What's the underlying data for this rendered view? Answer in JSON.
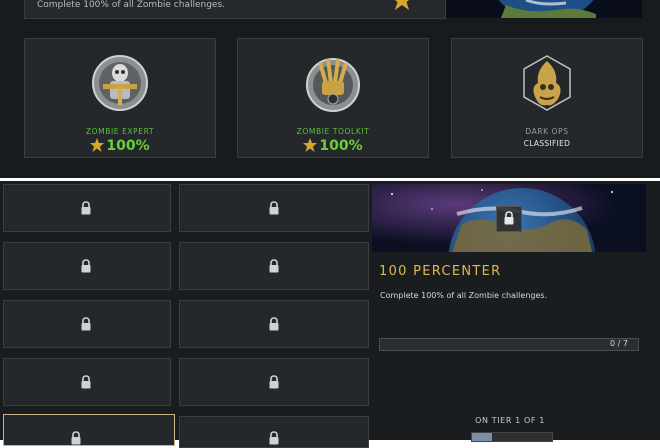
{
  "top": {
    "description": "Complete 100% of all Zombie challenges.",
    "cards": [
      {
        "name": "ZOMBIE EXPERT",
        "value": "100%",
        "name_color": "#5fbf3c",
        "emblem": "skull-soldier-emblem-icon"
      },
      {
        "name": "ZOMBIE TOOLKIT",
        "value": "100%",
        "name_color": "#5fbf3c",
        "emblem": "toolkit-emblem-icon"
      },
      {
        "name": "DARK OPS",
        "status": "CLASSIFIED",
        "name_color": "#9a9ca0",
        "emblem": "dark-ops-emblem-icon"
      }
    ]
  },
  "grid": {
    "lock_icon": "lock-icon",
    "tile_count": 10
  },
  "detail": {
    "title": "100 PERCENTER",
    "description": "Complete 100% of all Zombie challenges.",
    "progress_current": 0,
    "progress_max": 7,
    "progress_text": "0 / 7",
    "tier_text": "ON TIER 1 OF 1",
    "accent": "#e2b84c"
  }
}
